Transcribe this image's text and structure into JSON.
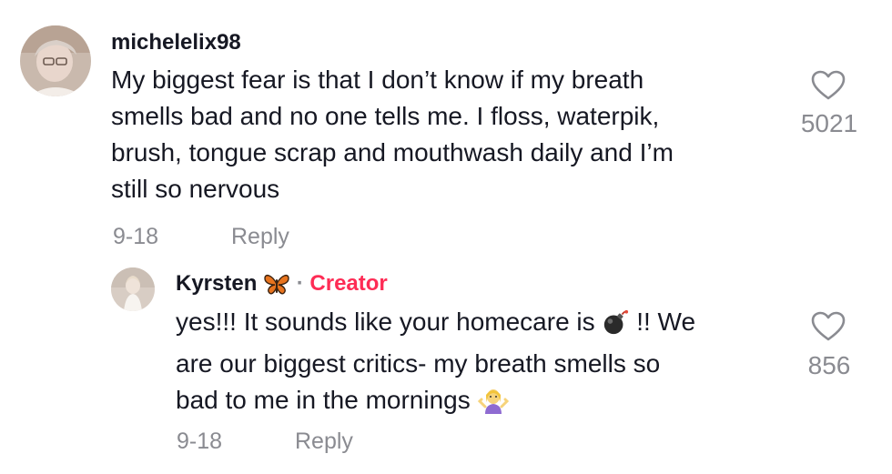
{
  "comment": {
    "username": "michelelix98",
    "text_lines": [
      "My biggest fear is that I don’t know if my breath",
      "smells bad and no one tells me. I floss, waterpik,",
      "brush, tongue scrap and mouthwash daily and I’m",
      "still so nervous"
    ],
    "date": "9-18",
    "reply_label": "Reply",
    "like_count": "5021",
    "like_icon": "heart-outline-icon"
  },
  "reply": {
    "username": "Kyrsten",
    "username_emoji": "butterfly-icon",
    "separator": "·",
    "badge": "Creator",
    "text_line1_a": "yes!!! It sounds like your homecare is",
    "text_line1_emoji": "bomb-icon",
    "text_line1_b": "!! We",
    "text_line2": "are our biggest critics- my breath smells so",
    "text_line3": "bad to me in the mornings",
    "text_line3_emoji": "person-shrugging-icon",
    "date": "9-18",
    "reply_label": "Reply",
    "like_count": "856",
    "like_icon": "heart-outline-icon"
  },
  "colors": {
    "primary_text": "#161823",
    "secondary_text": "#8a8b91",
    "creator_accent": "#fe2c55"
  }
}
